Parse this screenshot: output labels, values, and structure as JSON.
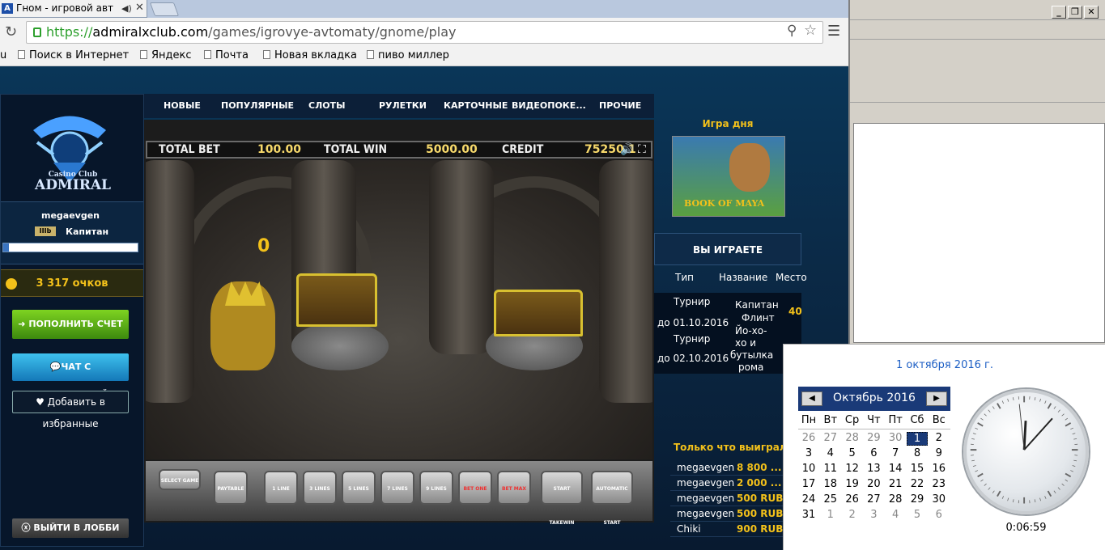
{
  "browser": {
    "tab_title": "Гном - игровой авт",
    "url_scheme": "https://",
    "url_host": "admiralxclub.com",
    "url_path": "/games/igrovye-avtomaty/gnome/play",
    "bookmarks": [
      "u",
      "Поиск в Интернет",
      "Яндекс",
      "Почта",
      "Новая вкладка",
      "пиво миллер"
    ]
  },
  "site": {
    "logo_small": "Casino Club",
    "logo_big": "ADMIRAL",
    "username": "megaevgen",
    "rank_icon": "IIIb",
    "rank": "Капитан",
    "progress": 0.04,
    "points": "3 317 очков",
    "btn_deposit": "ПОПОЛНИТЬ СЧЕТ",
    "btn_chat": "ЧАТ С ПОДДЕРЖКОЙ",
    "btn_fav_line1": "Добавить в",
    "btn_fav_line2": "избранные",
    "btn_exit": "ВЫЙТИ В ЛОББИ",
    "nav": [
      "НОВЫЕ",
      "ПОПУЛЯРНЫЕ",
      "СЛОТЫ",
      "РУЛЕТКИ",
      "КАРТОЧНЫЕ",
      "ВИДЕОПОКЕ...",
      "ПРОЧИЕ"
    ]
  },
  "game": {
    "total_bet_label": "TOTAL BET",
    "total_bet": "100.00",
    "total_win_label": "TOTAL WIN",
    "total_win": "5000.00",
    "credit_label": "CREDIT",
    "credit": "75250.1",
    "counter": "0",
    "controls": [
      "SELECT GAME",
      "PAYTABLE",
      "1 LINE",
      "3 LINES",
      "5 LINES",
      "7 LINES",
      "9 LINES",
      "BET ONE",
      "BET MAX",
      "START TAKEWIN",
      "AUTOMATIC START"
    ]
  },
  "right": {
    "gotd_title": "Игра дня",
    "gotd_name": "BOOK OF MAYA",
    "playing": "ВЫ ИГРАЕТЕ",
    "headers": [
      "Тип",
      "Название",
      "Место"
    ],
    "t1_type": "Турнир",
    "t1_date": "до 01.10.2016",
    "t1_name_a": "Капитан",
    "t1_name_b": "Флинт",
    "t1_place": "40",
    "t2_type": "Турнир",
    "t2_date": "до 02.10.2016",
    "t2_name_a": "Йо-хо-",
    "t2_name_b": "хо и",
    "t2_name_c": "бутылка",
    "t2_name_d": "рома",
    "won_title": "Только что выиграли",
    "won": [
      {
        "user": "megaevgen",
        "amount": "8 800 ..."
      },
      {
        "user": "megaevgen",
        "amount": "2 000 ..."
      },
      {
        "user": "megaevgen",
        "amount": "500 RUB"
      },
      {
        "user": "megaevgen",
        "amount": "500 RUB"
      },
      {
        "user": "Chiki",
        "amount": "900 RUB"
      }
    ]
  },
  "clock": {
    "date_long": "1 октября 2016 г.",
    "month": "Октябрь 2016",
    "dow": [
      "Пн",
      "Вт",
      "Ср",
      "Чт",
      "Пт",
      "Сб",
      "Вс"
    ],
    "rows": [
      [
        "26",
        "27",
        "28",
        "29",
        "30",
        "1",
        "2"
      ],
      [
        "3",
        "4",
        "5",
        "6",
        "7",
        "8",
        "9"
      ],
      [
        "10",
        "11",
        "12",
        "13",
        "14",
        "15",
        "16"
      ],
      [
        "17",
        "18",
        "19",
        "20",
        "21",
        "22",
        "23"
      ],
      [
        "24",
        "25",
        "26",
        "27",
        "28",
        "29",
        "30"
      ],
      [
        "31",
        "1",
        "2",
        "3",
        "4",
        "5",
        "6"
      ]
    ],
    "time": "0:06:59"
  }
}
